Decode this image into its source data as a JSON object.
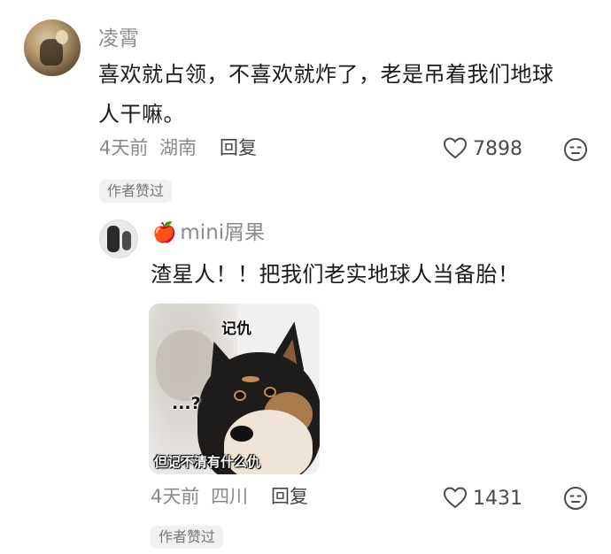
{
  "comment": {
    "username": "凌霄",
    "text_line1": "喜欢就占领，不喜欢就炸了，老是吊着我们地球",
    "text_line2": "人干嘛。",
    "time": "4天前",
    "location": "湖南",
    "reply_label": "回复",
    "likes": "7898",
    "badge": "作者赞过"
  },
  "reply": {
    "emoji": "🍎",
    "username": "mini屑果",
    "text": "渣星人！！把我们老实地球人当备胎！",
    "sticker": {
      "caption_top": "记仇",
      "caption_mid": "...?",
      "caption_bottom": "但记不清有什么仇"
    },
    "time": "4天前",
    "location": "四川",
    "reply_label": "回复",
    "likes": "1431",
    "badge": "作者赞过"
  },
  "icons": {
    "like": "heart-outline-icon",
    "dislike": "neutral-face-icon"
  }
}
